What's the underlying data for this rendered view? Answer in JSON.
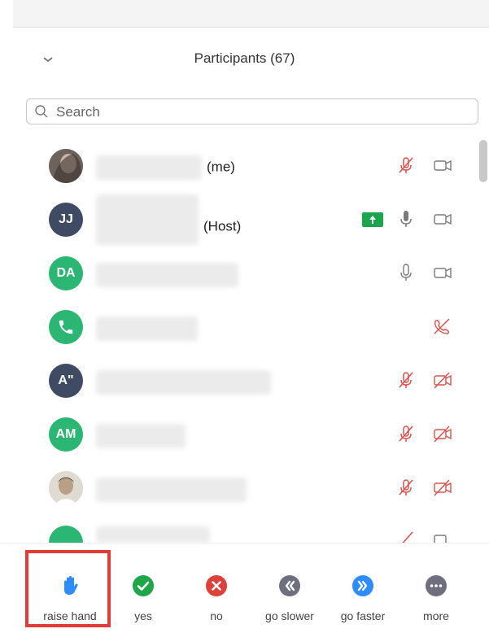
{
  "header": {
    "title": "Participants (67)"
  },
  "search": {
    "placeholder": "Search"
  },
  "participants": [
    {
      "tag": "(me)",
      "avatar": "photo",
      "mic": "muted",
      "video": "off-gray"
    },
    {
      "tag": "(Host)",
      "avatar": "JJ",
      "avatar_color": "#3e4b63",
      "mic": "on",
      "video": "off-gray",
      "sharing": true
    },
    {
      "tag": "",
      "avatar": "DA",
      "avatar_color": "#2bb673",
      "mic": "on",
      "video": "off-gray"
    },
    {
      "tag": "",
      "avatar": "phone",
      "avatar_color": "#2bb673",
      "mic": "phone-muted",
      "video": "none"
    },
    {
      "tag": "",
      "avatar": "A\"",
      "avatar_color": "#3e4b63",
      "mic": "muted",
      "video": "muted"
    },
    {
      "tag": "",
      "avatar": "AM",
      "avatar_color": "#2bb673",
      "mic": "muted",
      "video": "muted"
    },
    {
      "tag": "",
      "avatar": "photo2",
      "mic": "muted",
      "video": "muted"
    },
    {
      "tag": "",
      "avatar": "partial",
      "avatar_color": "#2bb673",
      "mic": "muted",
      "video": "off-gray"
    }
  ],
  "footer": {
    "buttons": [
      {
        "id": "raise-hand",
        "label": "raise hand",
        "color": "#2d8cff"
      },
      {
        "id": "yes",
        "label": "yes",
        "color": "#1fa54a"
      },
      {
        "id": "no",
        "label": "no",
        "color": "#e0403a"
      },
      {
        "id": "go-slower",
        "label": "go slower",
        "color": "#6d6f7e"
      },
      {
        "id": "go-faster",
        "label": "go faster",
        "color": "#2d8cff"
      },
      {
        "id": "more",
        "label": "more",
        "color": "#6d6f7e"
      }
    ]
  },
  "colors": {
    "muted_red": "#d9534f",
    "icon_gray": "#7a7a7a",
    "highlight": "#e23b3b"
  }
}
